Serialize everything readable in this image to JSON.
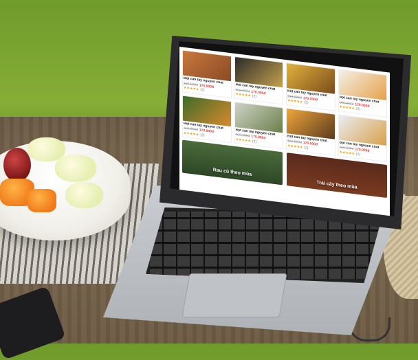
{
  "products": [
    {
      "name": "Bột cần tây nguyên chất",
      "old_price": "150.000đ",
      "new_price": "170.000đ",
      "stars": "★★★★★",
      "count": "(2)"
    },
    {
      "name": "Bột cần tây nguyên chất",
      "old_price": "150.000đ",
      "new_price": "170.000đ",
      "stars": "★★★★★",
      "count": "(2)"
    },
    {
      "name": "Bột cần tây nguyên chất",
      "old_price": "150.000đ",
      "new_price": "170.000đ",
      "stars": "★★★★★",
      "count": "(2)"
    },
    {
      "name": "Bột cần tây nguyên chất",
      "old_price": "150.000đ",
      "new_price": "170.000đ",
      "stars": "★★★★★",
      "count": "(2)"
    },
    {
      "name": "Bột cần tây nguyên chất",
      "old_price": "150.000đ",
      "new_price": "170.000đ",
      "stars": "★★★★★",
      "count": "(2)"
    },
    {
      "name": "Bột cần tây nguyên chất",
      "old_price": "150.000đ",
      "new_price": "170.000đ",
      "stars": "★★★★★",
      "count": "(2)"
    },
    {
      "name": "Bột cần tây nguyên chất",
      "old_price": "150.000đ",
      "new_price": "170.000đ",
      "stars": "★★★★★",
      "count": "(2)"
    },
    {
      "name": "Bột cần tây nguyên chất",
      "old_price": "150.000đ",
      "new_price": "170.000đ",
      "stars": "★★★★★",
      "count": "(2)"
    }
  ],
  "banners": {
    "left": "Rau củ theo mùa",
    "right": "Trái cây theo mùa"
  },
  "colors": {
    "price_new": "#e53935",
    "price_old": "#9a9a9a",
    "stars": "#ff9800"
  }
}
